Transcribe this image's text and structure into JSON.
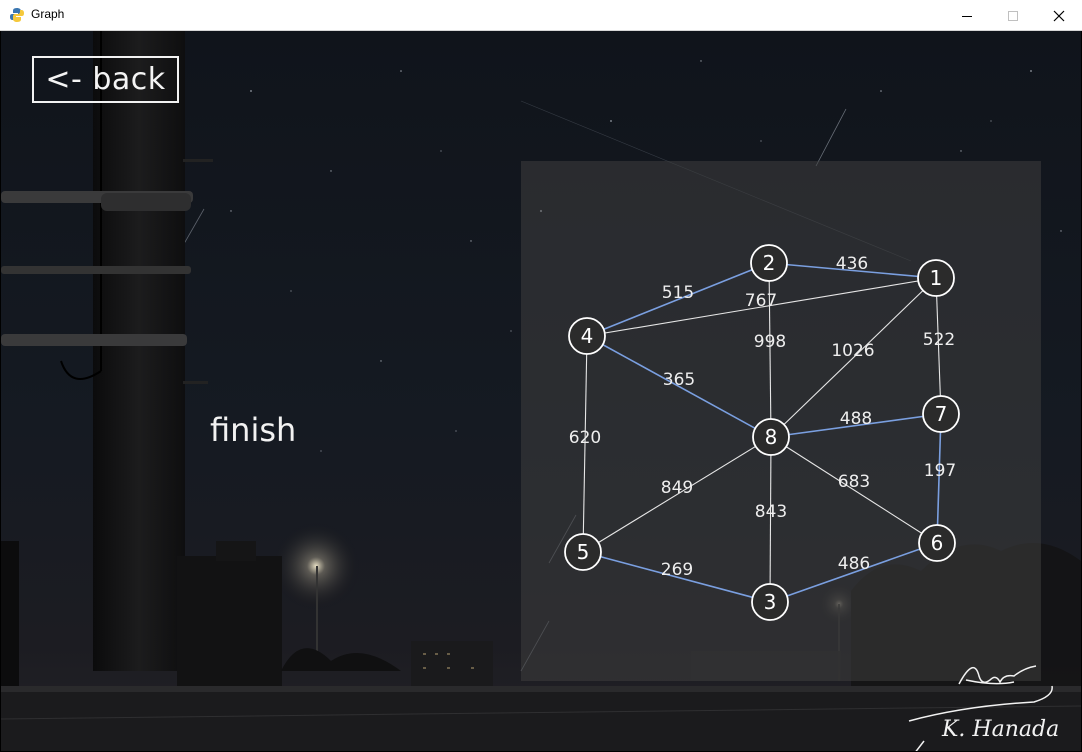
{
  "window": {
    "title": "Graph",
    "minimize_icon": "minimize-icon",
    "maximize_icon": "maximize-icon",
    "close_icon": "close-icon",
    "app_icon": "python-icon"
  },
  "back_button": {
    "label": "<- back"
  },
  "status": {
    "text": "finish"
  },
  "colors": {
    "highlight_edge": "#7a9fe0",
    "normal_edge": "#e6e6e6",
    "node_stroke": "#ffffff",
    "node_fill": "#2b2b2b",
    "panel": "#3e3e3e"
  },
  "graph": {
    "nodes": [
      {
        "id": "1",
        "label": "1"
      },
      {
        "id": "2",
        "label": "2"
      },
      {
        "id": "3",
        "label": "3"
      },
      {
        "id": "4",
        "label": "4"
      },
      {
        "id": "5",
        "label": "5"
      },
      {
        "id": "6",
        "label": "6"
      },
      {
        "id": "7",
        "label": "7"
      },
      {
        "id": "8",
        "label": "8"
      }
    ],
    "edges": [
      {
        "from": "2",
        "to": "1",
        "weight": "436",
        "in_tree": true
      },
      {
        "from": "4",
        "to": "2",
        "weight": "515",
        "in_tree": true
      },
      {
        "from": "4",
        "to": "1",
        "weight": "767",
        "in_tree": false
      },
      {
        "from": "2",
        "to": "8",
        "weight": "998",
        "in_tree": false
      },
      {
        "from": "1",
        "to": "8",
        "weight": "1026",
        "in_tree": false
      },
      {
        "from": "1",
        "to": "7",
        "weight": "522",
        "in_tree": false
      },
      {
        "from": "4",
        "to": "8",
        "weight": "365",
        "in_tree": true
      },
      {
        "from": "8",
        "to": "7",
        "weight": "488",
        "in_tree": true
      },
      {
        "from": "4",
        "to": "5",
        "weight": "620",
        "in_tree": false
      },
      {
        "from": "7",
        "to": "6",
        "weight": "197",
        "in_tree": true
      },
      {
        "from": "5",
        "to": "8",
        "weight": "849",
        "in_tree": false
      },
      {
        "from": "8",
        "to": "6",
        "weight": "683",
        "in_tree": false
      },
      {
        "from": "8",
        "to": "3",
        "weight": "843",
        "in_tree": false
      },
      {
        "from": "5",
        "to": "3",
        "weight": "269",
        "in_tree": true
      },
      {
        "from": "3",
        "to": "6",
        "weight": "486",
        "in_tree": true
      }
    ]
  },
  "signature": {
    "text": "K. Hanada"
  }
}
